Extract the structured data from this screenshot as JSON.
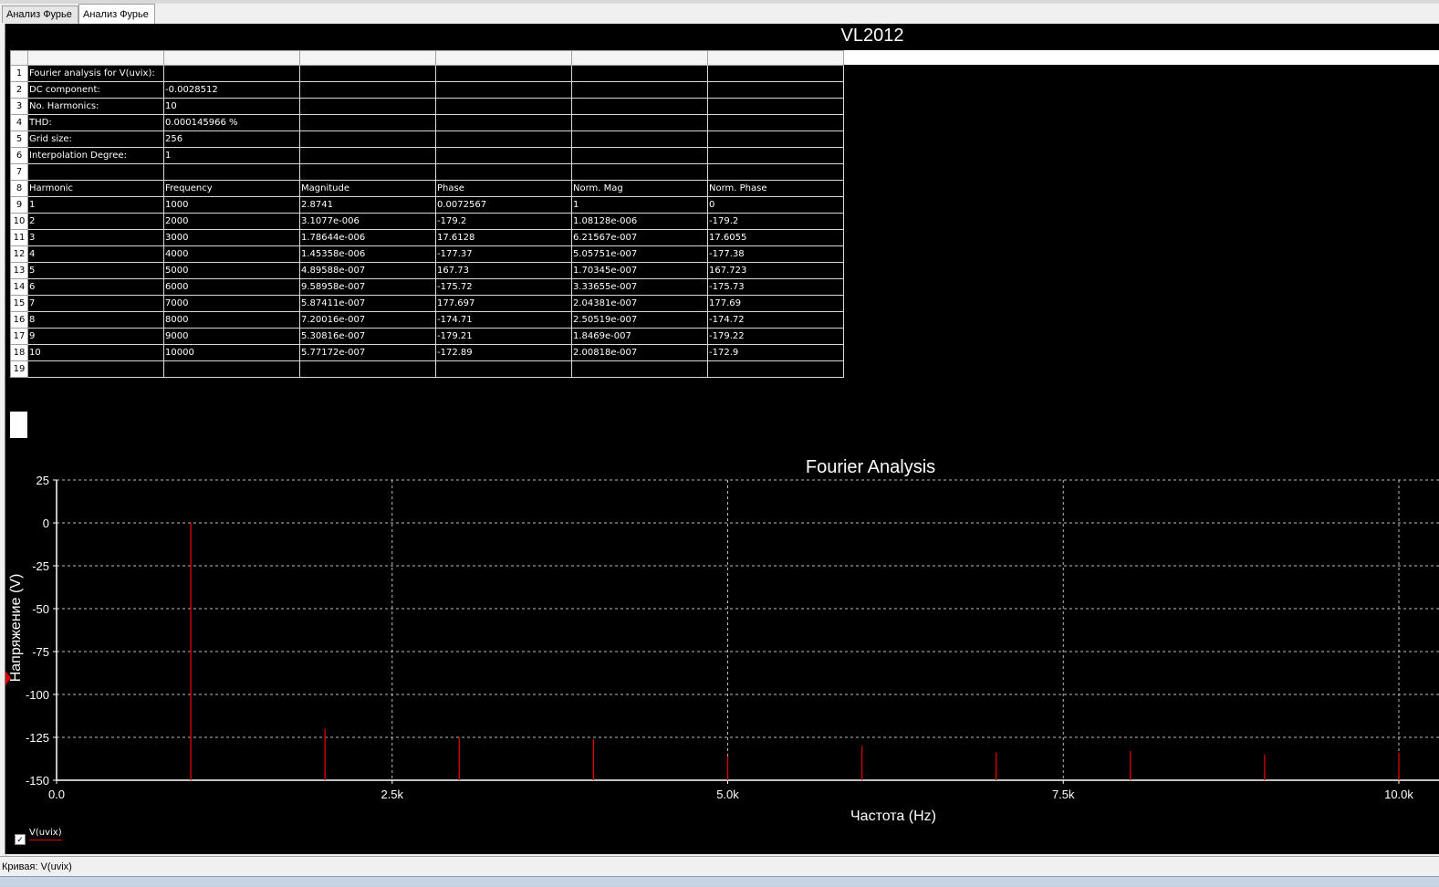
{
  "tabs": [
    "Анализ Фурье",
    "Анализ Фурье"
  ],
  "active_tab": 1,
  "panel_title": "VL2012",
  "table": {
    "rows": [
      [
        "1",
        "Fourier analysis for V(uvix):",
        "",
        "",
        "",
        "",
        ""
      ],
      [
        "2",
        "DC component:",
        "-0.0028512",
        "",
        "",
        "",
        ""
      ],
      [
        "3",
        "No. Harmonics:",
        "10",
        "",
        "",
        "",
        ""
      ],
      [
        "4",
        "THD:",
        "0.000145966 %",
        "",
        "",
        "",
        ""
      ],
      [
        "5",
        "Grid size:",
        "256",
        "",
        "",
        "",
        ""
      ],
      [
        "6",
        "Interpolation Degree:",
        "1",
        "",
        "",
        "",
        ""
      ],
      [
        "7",
        "",
        "",
        "",
        "",
        "",
        ""
      ],
      [
        "8",
        "Harmonic",
        "Frequency",
        "Magnitude",
        "Phase",
        "Norm. Mag",
        "Norm. Phase"
      ],
      [
        "9",
        "1",
        "1000",
        "2.8741",
        "0.0072567",
        "1",
        "0"
      ],
      [
        "10",
        "2",
        "2000",
        "3.1077e-006",
        "-179.2",
        "1.08128e-006",
        "-179.2"
      ],
      [
        "11",
        "3",
        "3000",
        "1.78644e-006",
        "17.6128",
        "6.21567e-007",
        "17.6055"
      ],
      [
        "12",
        "4",
        "4000",
        "1.45358e-006",
        "-177.37",
        "5.05751e-007",
        "-177.38"
      ],
      [
        "13",
        "5",
        "5000",
        "4.89588e-007",
        "167.73",
        "1.70345e-007",
        "167.723"
      ],
      [
        "14",
        "6",
        "6000",
        "9.58958e-007",
        "-175.72",
        "3.33655e-007",
        "-175.73"
      ],
      [
        "15",
        "7",
        "7000",
        "5.87411e-007",
        "177.697",
        "2.04381e-007",
        "177.69"
      ],
      [
        "16",
        "8",
        "8000",
        "7.20016e-007",
        "-174.71",
        "2.50519e-007",
        "-174.72"
      ],
      [
        "17",
        "9",
        "9000",
        "5.30816e-007",
        "-179.21",
        "1.8469e-007",
        "-179.22"
      ],
      [
        "18",
        "10",
        "10000",
        "5.77172e-007",
        "-172.89",
        "2.00818e-007",
        "-172.9"
      ],
      [
        "19",
        "",
        "",
        "",
        "",
        "",
        ""
      ]
    ]
  },
  "chart_data": {
    "type": "bar",
    "title": "Fourier Analysis",
    "xlabel": "Частота (Hz)",
    "ylabel": "Напряжение (V)",
    "xlim": [
      0,
      10000
    ],
    "ylim": [
      -150,
      25
    ],
    "xticks": [
      0,
      2500,
      5000,
      7500,
      10000
    ],
    "xtick_labels": [
      "0.0",
      "2.5k",
      "5.0k",
      "7.5k",
      "10.0k"
    ],
    "yticks": [
      25,
      0,
      -25,
      -50,
      -75,
      -100,
      -125,
      -150
    ],
    "ytick_labels": [
      "25",
      "0",
      "-25",
      "-50",
      "-75",
      "-100",
      "-125",
      "-150"
    ],
    "grid": true,
    "baseline": -150,
    "series": [
      {
        "name": "V(uvix)",
        "color": "#e00000",
        "x": [
          1000,
          2000,
          3000,
          4000,
          5000,
          6000,
          7000,
          8000,
          9000,
          10000
        ],
        "values": [
          0,
          -120,
          -125,
          -126,
          -136,
          -130,
          -134,
          -133,
          -135,
          -134
        ]
      }
    ]
  },
  "legend": {
    "label": "V(uvix)",
    "checked": true
  },
  "status_bar": "Кривая: V(uvix)",
  "colors": {
    "background": "#000000",
    "trace": "#e00000",
    "grid": "#bbbbbb",
    "text": "#ffffff"
  }
}
